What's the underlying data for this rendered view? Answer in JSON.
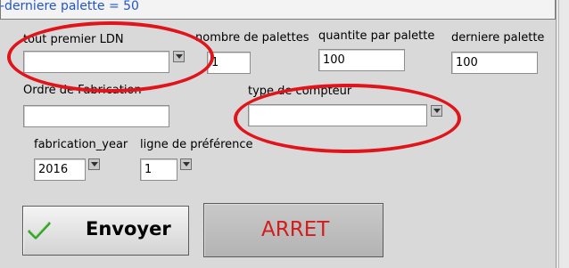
{
  "info": {
    "text": "-derniere palette = 50"
  },
  "form": {
    "tout_premier_ldn": {
      "label": "tout premier LDN",
      "value": ""
    },
    "nombre_de_palettes": {
      "label": "nombre de palettes",
      "value": "1"
    },
    "quantite_par_palette": {
      "label": "quantite par palette",
      "value": "100"
    },
    "derniere_palette": {
      "label": "derniere palette",
      "value": "100"
    },
    "ordre_de_fabrication": {
      "label": "Ordre de Fabrication",
      "value": ""
    },
    "type_de_compteur": {
      "label": "type de compteur",
      "value": ""
    },
    "fabrication_year": {
      "label": "fabrication_year",
      "value": "2016"
    },
    "ligne_de_preference": {
      "label": "ligne de préférence",
      "value": "1"
    }
  },
  "buttons": {
    "send": {
      "label": "Envoyer",
      "icon": "checkmark-icon"
    },
    "stop": {
      "label": "ARRET"
    }
  },
  "colors": {
    "info_text": "#2255cc",
    "stop_label": "#d41c1c",
    "annotation": "#e0141b",
    "check_icon": "#3aa32f"
  }
}
